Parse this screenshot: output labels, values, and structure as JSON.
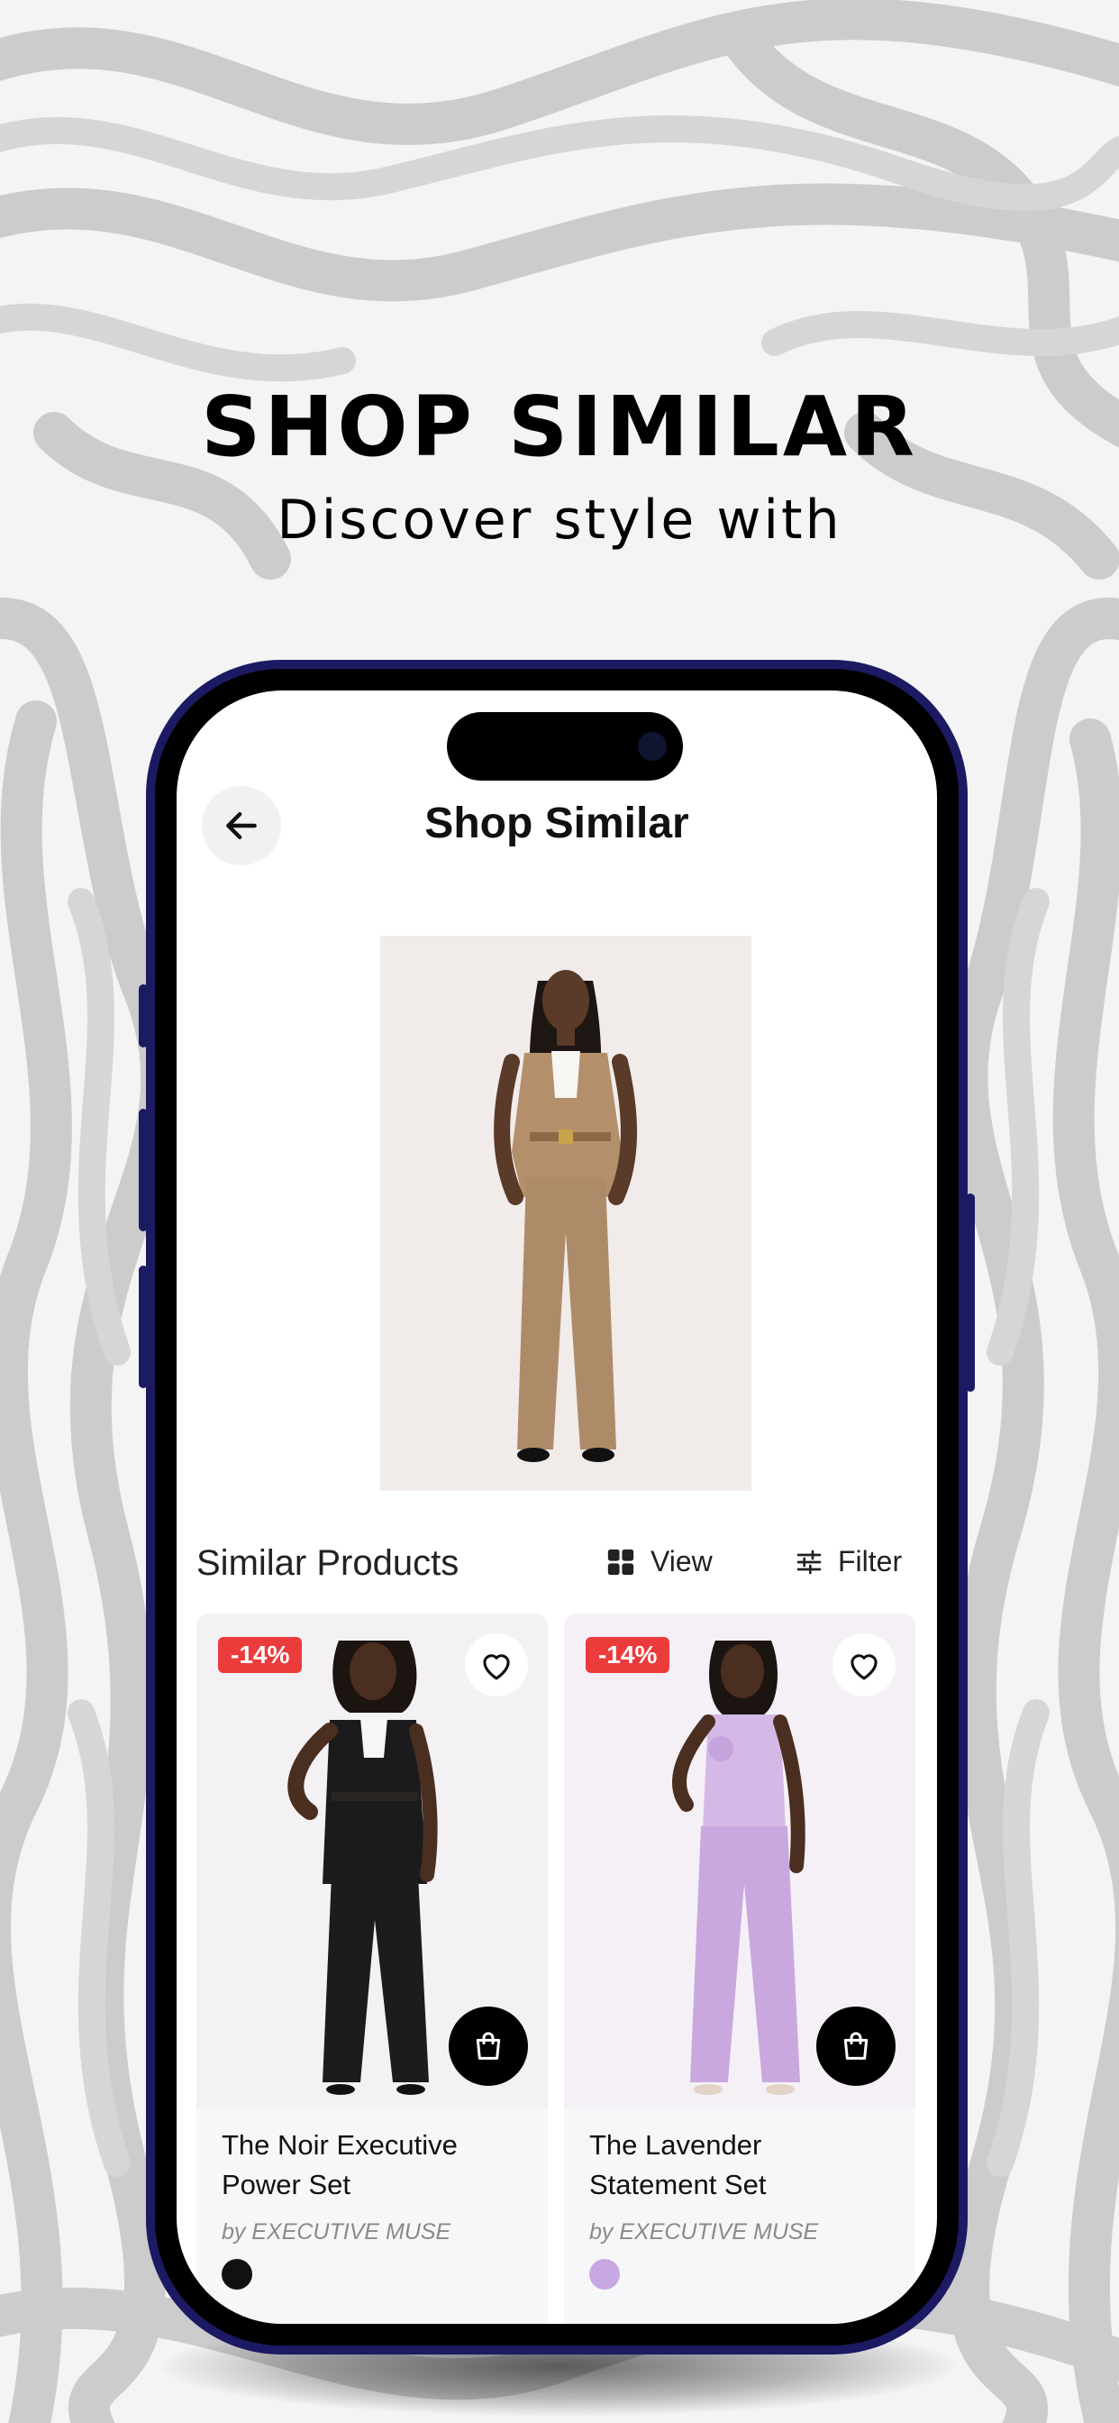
{
  "promo": {
    "title": "SHOP  SIMILAR",
    "subtitle": "Discover style with"
  },
  "app": {
    "header": {
      "back_icon": "arrow-left-icon",
      "title": "Shop Similar"
    },
    "section": {
      "title": "Similar Products",
      "view_label": "View",
      "view_icon": "grid-icon",
      "filter_label": "Filter",
      "filter_icon": "sliders-icon"
    },
    "products": [
      {
        "discount": "-14%",
        "name": "The Noir Executive Power Set",
        "brand": "by EXECUTIVE MUSE",
        "swatch_color": "#111111",
        "heart_icon": "heart-outline-icon",
        "bag_icon": "shopping-bag-icon"
      },
      {
        "discount": "-14%",
        "name": "The Lavender Statement Set",
        "brand": "by EXECUTIVE MUSE",
        "swatch_color": "#c8a8e2",
        "heart_icon": "heart-outline-icon",
        "bag_icon": "shopping-bag-icon"
      }
    ]
  },
  "colors": {
    "phone_frame": "#1c1a63",
    "discount_badge": "#ec3b3b",
    "background_pattern": "#c9c9c9"
  }
}
